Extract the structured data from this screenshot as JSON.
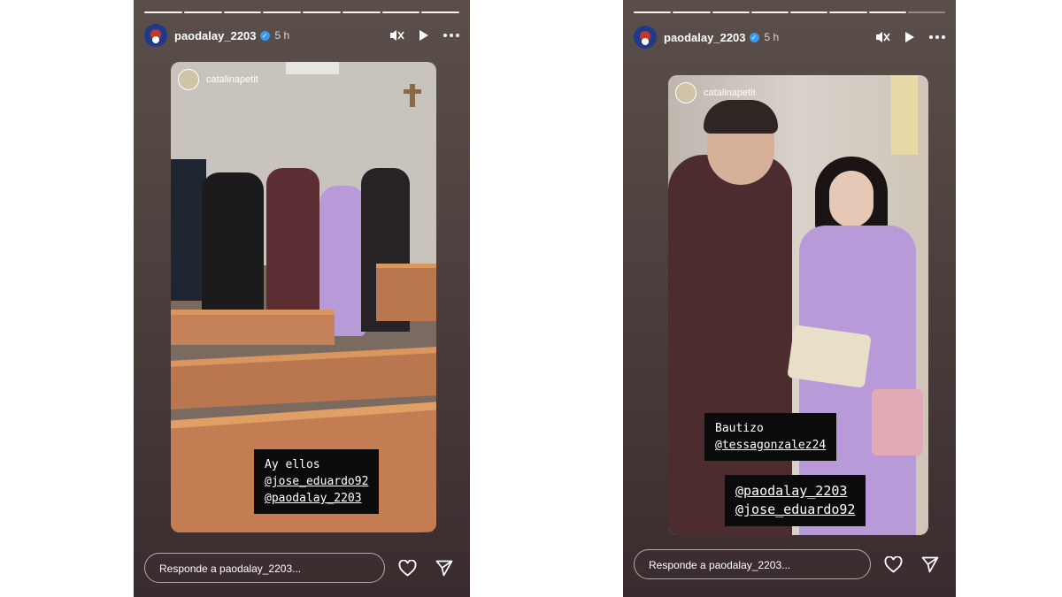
{
  "stories": [
    {
      "username": "paodalay_2203",
      "time": "5 h",
      "verified_mark": "✓",
      "icons": [
        "mute-icon",
        "play-icon",
        "more-icon"
      ],
      "reposted_from": "catalinapetit",
      "caption_lines": [
        "Ay ellos",
        "@jose_eduardo92",
        "@paodalay_2203"
      ],
      "reply_placeholder": "Responde a paodalay_2203...",
      "progress": {
        "segments": 8,
        "completed": 8
      }
    },
    {
      "username": "paodalay_2203",
      "time": "5 h",
      "verified_mark": "✓",
      "icons": [
        "mute-icon",
        "play-icon",
        "more-icon"
      ],
      "reposted_from": "catalinapetit",
      "caption_top": [
        "Bautizo",
        "@tessagonzalez24"
      ],
      "caption_bottom": [
        "@paodalay_2203",
        "@jose_eduardo92"
      ],
      "reply_placeholder": "Responde a paodalay_2203...",
      "progress": {
        "segments": 8,
        "completed": 7
      }
    }
  ],
  "colors": {
    "verified": "#3897f0",
    "pew_wood": "#c5825a",
    "dress_purple": "#b89ad8",
    "caption_bg": "#0b0b0b"
  }
}
